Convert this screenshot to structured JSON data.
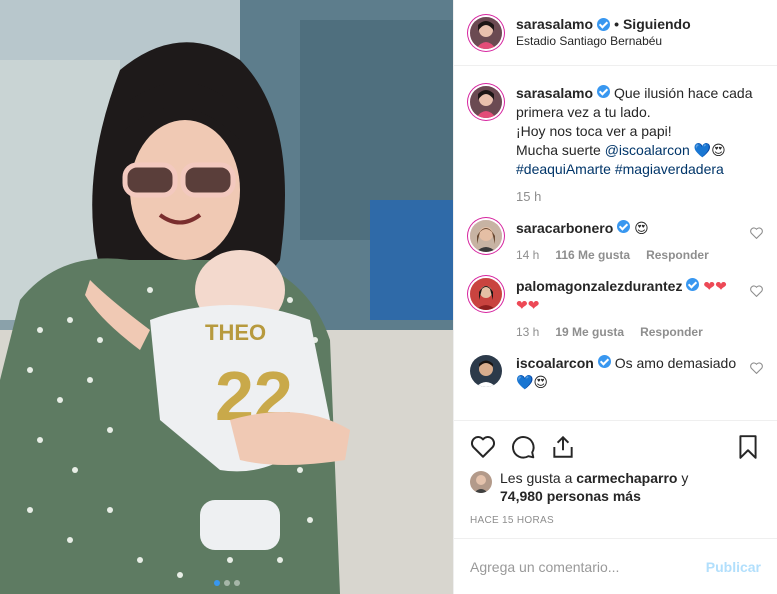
{
  "header": {
    "username": "sarasalamo",
    "separator": "•",
    "follow_status": "Siguiendo",
    "location": "Estadio Santiago Bernabéu"
  },
  "caption": {
    "username": "sarasalamo",
    "line1": "Que ilusión hace cada",
    "line2": "primera vez a tu lado.",
    "line3": "¡Hoy nos toca ver a papi!",
    "line4_prefix": "Mucha suerte",
    "mention": "@iscoalarcon",
    "emojis": "💙😍",
    "hashtag1": "#deaquiAmarte",
    "hashtag2": "#magiaverdadera",
    "time": "15 h"
  },
  "comments": [
    {
      "username": "saracarbonero",
      "text": "😍",
      "time": "14 h",
      "likes": "116 Me gusta",
      "reply": "Responder"
    },
    {
      "username": "palomagonzalezdurantez",
      "text_line1": "❤❤",
      "text_line2": "❤❤",
      "time": "13 h",
      "likes": "19 Me gusta",
      "reply": "Responder"
    },
    {
      "username": "iscoalarcon",
      "text_line1": "Os amo demasiado",
      "text_line2": "💙😍"
    }
  ],
  "likes": {
    "prefix": "Les gusta a",
    "user": "carmechaparro",
    "conjunction": "y",
    "count": "74,980 personas más"
  },
  "posted_ago": "HACE 15 HORAS",
  "add_comment": {
    "placeholder": "Agrega un comentario...",
    "publish_label": "Publicar"
  },
  "photo": {
    "jersey_name": "THEO",
    "jersey_number": "22"
  },
  "colors": {
    "verified_blue": "#3897f0",
    "link_dark_blue": "#003569",
    "muted_gray": "#8e8e8e",
    "publish_disabled": "#b2dffc",
    "heart_red": "#ed4956"
  }
}
